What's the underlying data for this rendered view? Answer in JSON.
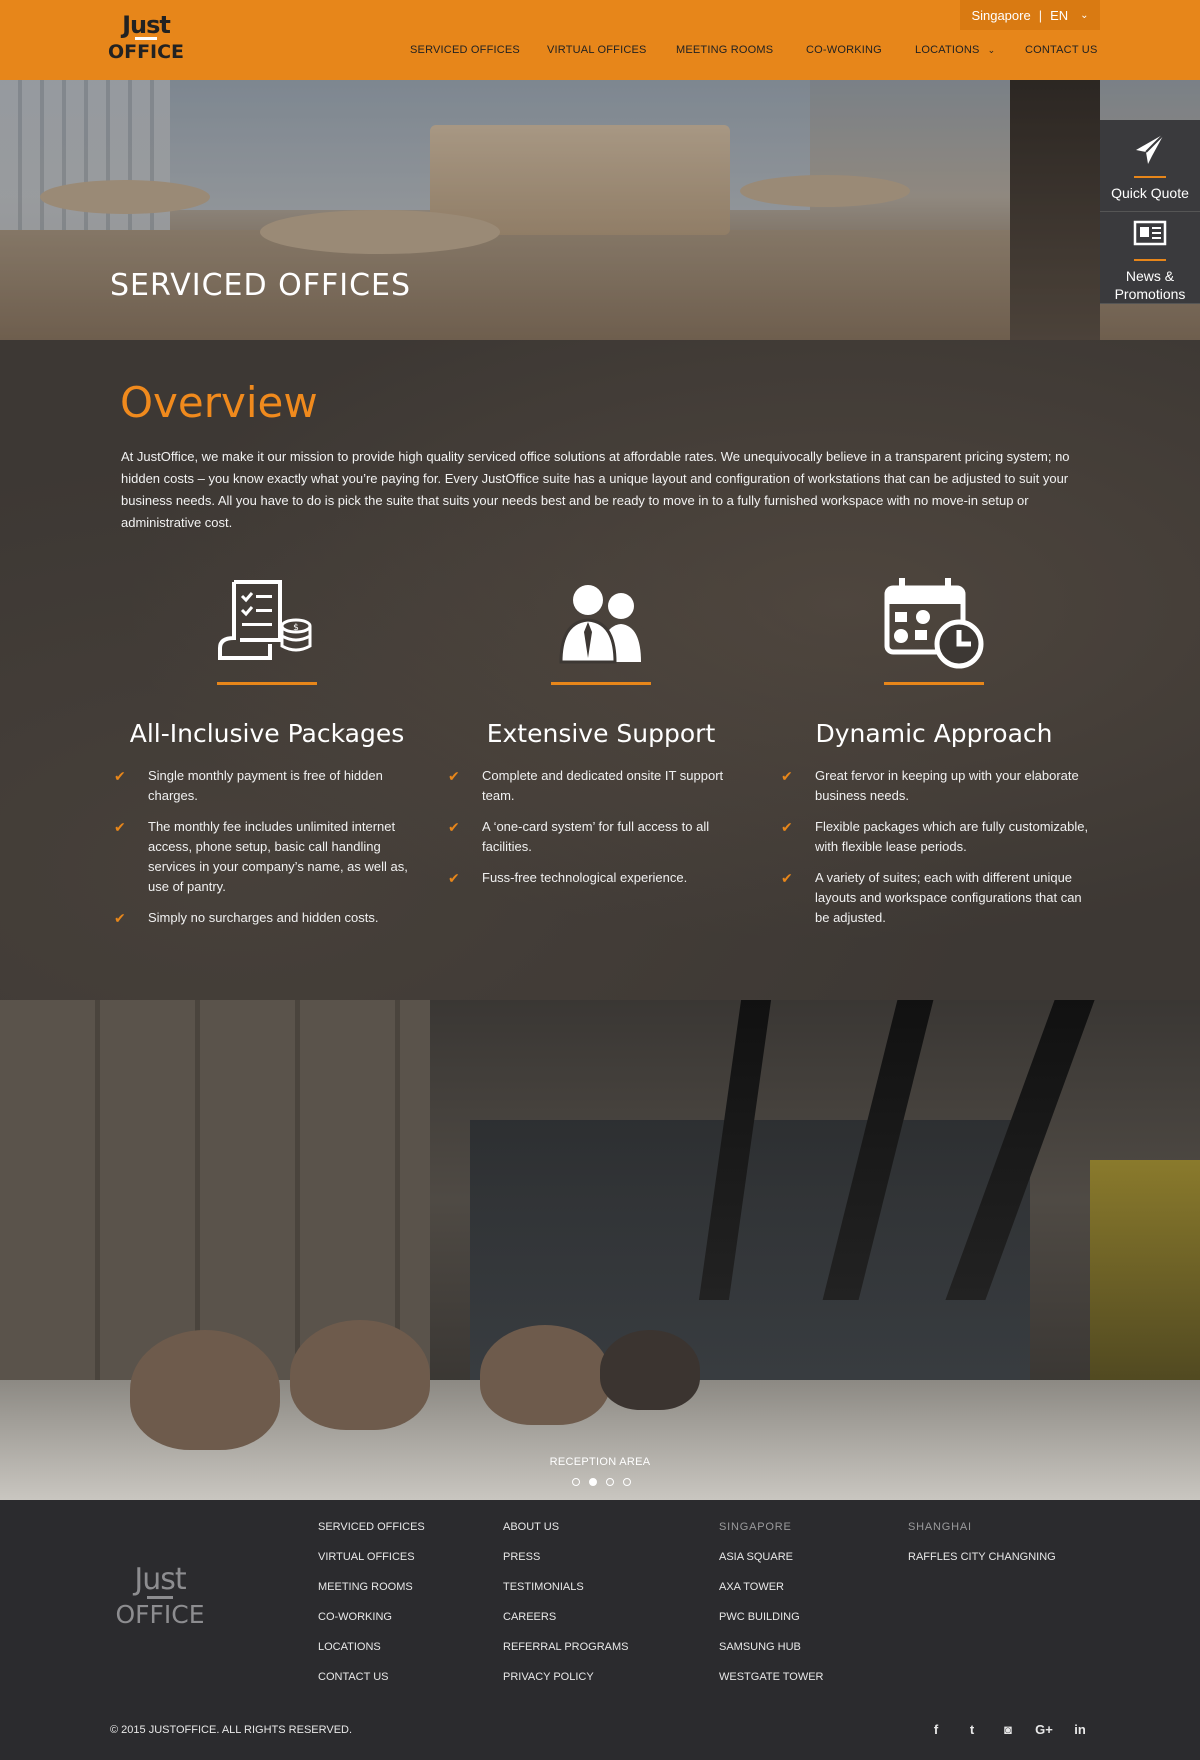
{
  "header": {
    "logo_top": "Just",
    "logo_bottom": "OFFICE",
    "country": "Singapore",
    "separator": "|",
    "language": "EN",
    "nav": [
      {
        "label": "SERVICED OFFICES"
      },
      {
        "label": "VIRTUAL OFFICES"
      },
      {
        "label": "MEETING ROOMS"
      },
      {
        "label": "CO-WORKING"
      },
      {
        "label": "LOCATIONS"
      },
      {
        "label": "CONTACT US"
      }
    ]
  },
  "hero": {
    "title": "SERVICED OFFICES"
  },
  "side_widgets": {
    "quote": "Quick Quote",
    "news_line1": "News &",
    "news_line2": "Promotions"
  },
  "overview": {
    "heading": "Overview",
    "intro": "At JustOffice, we make it our mission to provide high quality serviced office solutions at affordable rates. We unequivocally believe in a transparent pricing system; no hidden costs – you know exactly what you’re paying for. Every JustOffice suite has a unique layout and configuration of workstations that can be adjusted to suit your business needs. All you have to do is pick the suite that suits your needs best and be ready to move in to a fully furnished workspace with no move-in setup or administrative cost.",
    "features": [
      {
        "title": "All-Inclusive Packages",
        "icon": "invoice-coins-icon",
        "items": [
          "Single monthly payment is free of hidden charges.",
          "The monthly fee includes unlimited internet access, phone setup, basic call handling services in your company’s name, as well as, use of pantry.",
          "Simply no surcharges and hidden costs."
        ]
      },
      {
        "title": "Extensive Support",
        "icon": "support-people-icon",
        "items": [
          "Complete and dedicated onsite IT support team.",
          "A ‘one-card system’ for full access to all facilities.",
          "Fuss-free technological experience."
        ]
      },
      {
        "title": "Dynamic Approach",
        "icon": "calendar-clock-icon",
        "items": [
          "Great fervor in keeping up with your elaborate business needs.",
          "Flexible packages which are fully customizable, with flexible lease periods.",
          "A variety of suites; each with different unique layouts and workspace configurations that can be adjusted."
        ]
      }
    ]
  },
  "gallery": {
    "caption": "RECEPTION AREA",
    "slide_count": 4,
    "active_slide": 2
  },
  "footer": {
    "logo_top": "Just",
    "logo_bottom": "OFFICE",
    "col1": [
      "SERVICED OFFICES",
      "VIRTUAL OFFICES",
      "MEETING ROOMS",
      "CO-WORKING",
      "LOCATIONS",
      "CONTACT US"
    ],
    "col2": [
      "ABOUT US",
      "PRESS",
      "TESTIMONIALS",
      "CAREERS",
      "REFERRAL PROGRAMS",
      "PRIVACY POLICY"
    ],
    "singapore_head": "SINGAPORE",
    "singapore": [
      "ASIA SQUARE",
      "AXA TOWER",
      "PWC BUILDING",
      "SAMSUNG HUB",
      "WESTGATE TOWER"
    ],
    "shanghai_head": "SHANGHAI",
    "shanghai": [
      "RAFFLES CITY CHANGNING"
    ],
    "copyright": "© 2015 JUSTOFFICE. ALL RIGHTS RESERVED.",
    "social": [
      {
        "icon": "facebook-icon",
        "glyph": "f"
      },
      {
        "icon": "twitter-icon",
        "glyph": "t"
      },
      {
        "icon": "instagram-icon",
        "glyph": "◙"
      },
      {
        "icon": "google-plus-icon",
        "glyph": "G+"
      },
      {
        "icon": "linkedin-icon",
        "glyph": "in"
      }
    ]
  },
  "colors": {
    "brand_orange": "#e7861a",
    "header_orange": "#e7861a",
    "overview_bg": "#3d3834",
    "footer_bg": "#2b2b2e"
  }
}
